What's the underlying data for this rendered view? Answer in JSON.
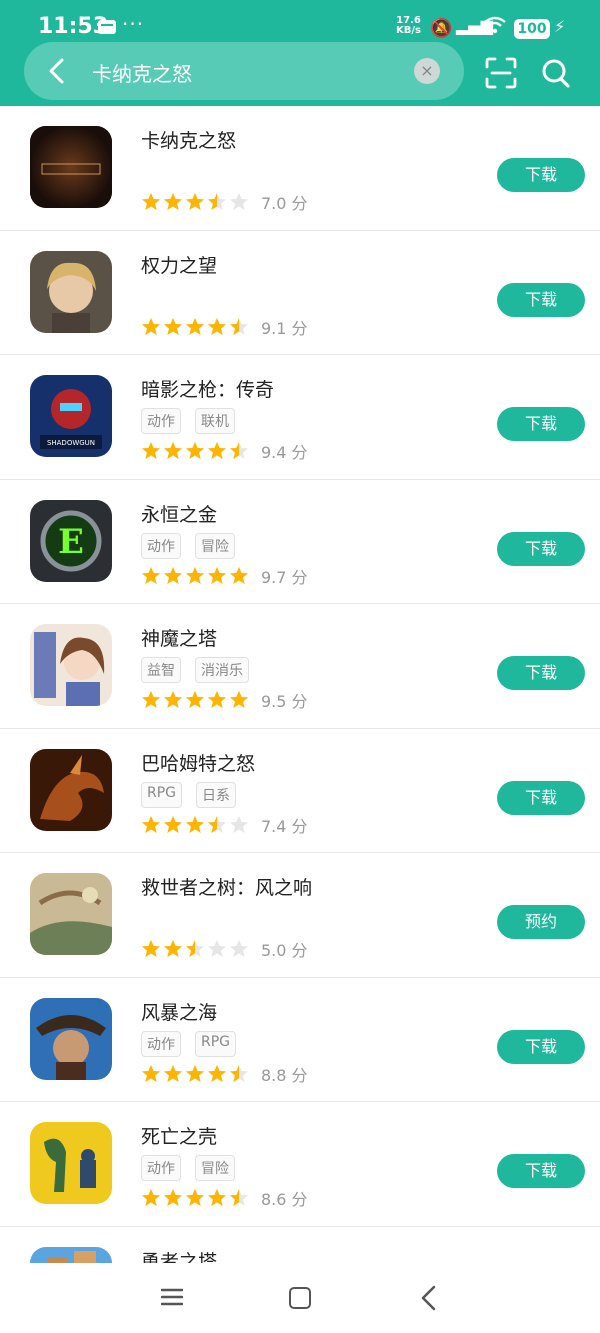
{
  "status_bar": {
    "time": "11:53",
    "net_speed_value": "17.6",
    "net_speed_unit": "KB/s",
    "battery": "100",
    "icons": [
      "message-icon",
      "more-icon",
      "mute-icon",
      "signal-icon",
      "wifi-icon",
      "battery-icon",
      "charging-icon"
    ]
  },
  "search": {
    "query": "卡纳克之怒",
    "clear_symbol": "×"
  },
  "colors": {
    "accent": "#1fb89c",
    "star_full": "#ffb400",
    "star_empty": "#e6e6e6"
  },
  "results": [
    {
      "name": "卡纳克之怒",
      "tags": [],
      "rating": 3.5,
      "score": "7.0 分",
      "button": "下载",
      "icon": "karnak-game-icon"
    },
    {
      "name": "权力之望",
      "tags": [],
      "rating": 4.5,
      "score": "9.1 分",
      "button": "下载",
      "icon": "blonde-character-icon"
    },
    {
      "name": "暗影之枪：传奇",
      "tags": [
        "动作",
        "联机"
      ],
      "rating": 4.5,
      "score": "9.4 分",
      "button": "下载",
      "icon": "shadowgun-robot-icon"
    },
    {
      "name": "永恒之金",
      "tags": [
        "动作",
        "冒险"
      ],
      "rating": 5,
      "score": "9.7 分",
      "button": "下载",
      "icon": "green-e-emblem-icon"
    },
    {
      "name": "神魔之塔",
      "tags": [
        "益智",
        "消消乐"
      ],
      "rating": 5,
      "score": "9.5 分",
      "button": "下载",
      "icon": "anime-girl-icon"
    },
    {
      "name": "巴哈姆特之怒",
      "tags": [
        "RPG",
        "日系"
      ],
      "rating": 3.5,
      "score": "7.4 分",
      "button": "下载",
      "icon": "dragon-icon"
    },
    {
      "name": "救世者之树：风之响",
      "tags": [],
      "rating": 2.5,
      "score": "5.0 分",
      "button": "预约",
      "icon": "fantasy-landscape-icon"
    },
    {
      "name": "风暴之海",
      "tags": [
        "动作",
        "RPG"
      ],
      "rating": 4.5,
      "score": "8.8 分",
      "button": "下载",
      "icon": "pirate-captain-icon"
    },
    {
      "name": "死亡之壳",
      "tags": [
        "动作",
        "冒险"
      ],
      "rating": 4.5,
      "score": "8.6 分",
      "button": "下载",
      "icon": "alien-soldier-icon"
    },
    {
      "name": "勇者之塔",
      "tags": [],
      "rating": 0,
      "score": "",
      "button": "",
      "icon": "tower-castle-icon"
    }
  ],
  "nav": {
    "icons": [
      "menu-icon",
      "home-icon",
      "back-icon"
    ]
  }
}
